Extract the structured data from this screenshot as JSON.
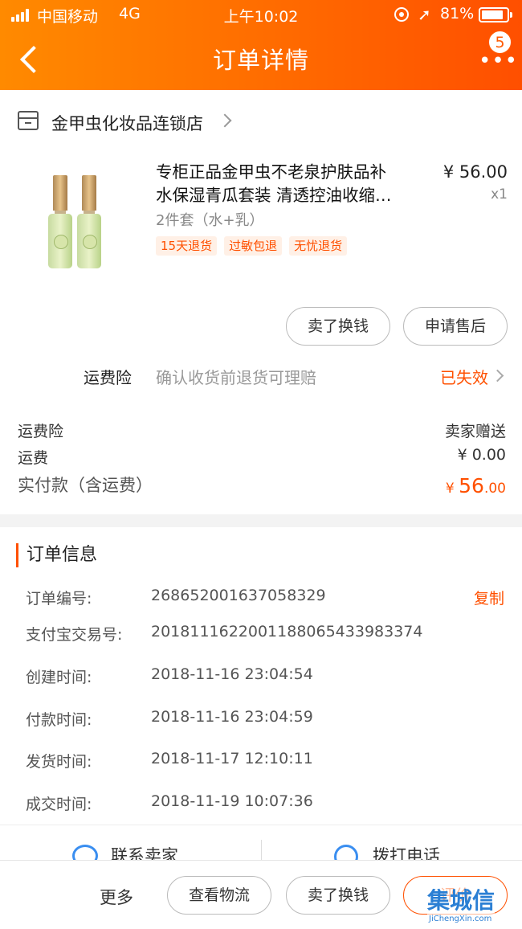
{
  "status_bar": {
    "carrier": "中国移动",
    "network": "4G",
    "time": "上午10:02",
    "battery": "81%"
  },
  "header": {
    "title": "订单详情",
    "badge_count": "5",
    "more_glyph": "•••"
  },
  "shop": {
    "name": "金甲虫化妆品连锁店"
  },
  "product": {
    "title_line1": "专柜正品金甲虫不老泉护肤品补",
    "title_line2": "水保湿青瓜套装 清透控油收缩…",
    "price": "¥ 56.00",
    "qty": "x1",
    "sku": "2件套（水+乳）",
    "tags": [
      "15天退货",
      "过敏包退",
      "无忧退货"
    ]
  },
  "item_actions": {
    "sell_label": "卖了换钱",
    "aftersale_label": "申请售后"
  },
  "insurance": {
    "label": "运费险",
    "desc": "确认收货前退货可理赔",
    "status": "已失效"
  },
  "fees": {
    "insurance_label": "运费险",
    "insurance_value": "卖家赠送",
    "shipping_label": "运费",
    "shipping_value": "¥ 0.00",
    "paid_label": "实付款（含运费）",
    "paid_currency": "¥ ",
    "paid_int": "56",
    "paid_dec": ".00"
  },
  "order_info": {
    "heading": "订单信息",
    "copy_label": "复制",
    "rows": [
      {
        "key": "订单编号:",
        "value": "268652001637058329"
      },
      {
        "key": "支付宝交易号:",
        "value": "2018111622001188065433983374"
      },
      {
        "key": "创建时间:",
        "value": "2018-11-16 23:04:54"
      },
      {
        "key": "付款时间:",
        "value": "2018-11-16 23:04:59"
      },
      {
        "key": "发货时间:",
        "value": "2018-11-17 12:10:11"
      },
      {
        "key": "成交时间:",
        "value": "2018-11-19 10:07:36"
      }
    ]
  },
  "contact": {
    "seller_label": "联系卖家",
    "call_label": "拨打电话"
  },
  "bottom_bar": {
    "more_label": "更多",
    "logistics_label": "查看物流",
    "sell_label": "卖了换钱",
    "rate_label": "评价"
  },
  "watermark": {
    "logo": "集城信",
    "url": "JiChengXin.com"
  },
  "colors": {
    "accent": "#ff5000",
    "header_start": "#ff8a00",
    "header_end": "#ff4f00",
    "link_blue": "#3a8ef0"
  }
}
